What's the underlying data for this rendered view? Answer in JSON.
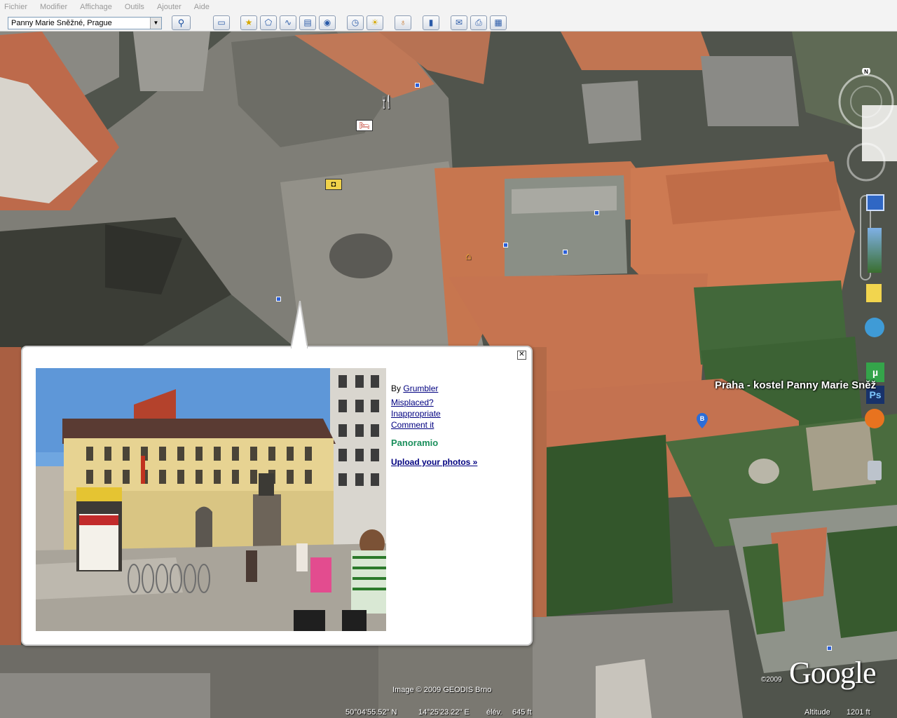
{
  "menu": [
    "Fichier",
    "Modifier",
    "Affichage",
    "Outils",
    "Ajouter",
    "Aide"
  ],
  "search": {
    "value": "Panny Marie Sněžné, Prague"
  },
  "toolbar_icons": [
    "sidebar-toggle-icon",
    "placemark-icon",
    "polygon-icon",
    "path-icon",
    "image-overlay-icon",
    "record-tour-icon",
    "historical-imagery-icon",
    "sunlight-icon",
    "switch-sky-icon",
    "ruler-icon",
    "email-icon",
    "print-icon",
    "view-in-maps-icon"
  ],
  "map": {
    "placemark_label": "Praha - kostel Panny Marie Sněž",
    "placemark_letter": "B",
    "copyright": "Image © 2009 GEODIS Brno",
    "google_logo": "Google",
    "google_year": "©2009"
  },
  "balloon": {
    "by_label": "By",
    "author": "Grumbler",
    "misplaced": "Misplaced?",
    "inappropriate": "Inappropriate",
    "comment": "Comment it",
    "panoramio": "Panoramio",
    "upload": "Upload your photos »",
    "close": "✕"
  },
  "status": {
    "lat": "50°04'55.52\" N",
    "lon": "14°25'23.22\" E",
    "elev_label": "élév.",
    "elev": "645 ft",
    "alt_label": "Altitude",
    "alt": "1201 ft"
  },
  "nav": {
    "north": "N"
  },
  "colors": {
    "roof": "#c9764f",
    "grass": "#3d6a33",
    "street": "#8e8d86",
    "link": "#000080",
    "panoramio": "#1b8f5c"
  }
}
